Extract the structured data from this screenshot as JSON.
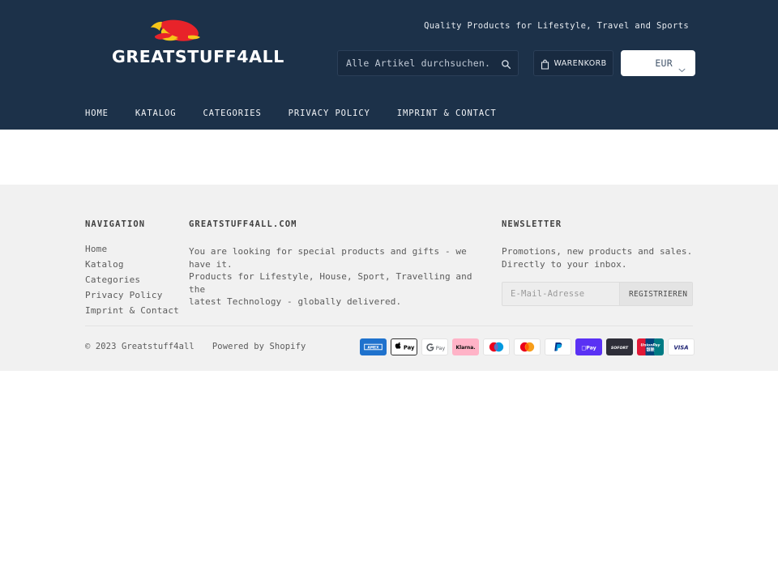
{
  "theme": {
    "header_bg": "#1c3149",
    "footer_bg": "#f1f1f1",
    "body_bg": "#ffffff",
    "logo_red": "#e8232a",
    "logo_yellow": "#f5c518",
    "accent_text": "#5b5b5b"
  },
  "header": {
    "logo_text": "GREATSTUFF4ALL",
    "logo_icon": "flame-swoosh-logo",
    "tagline": "Quality Products for Lifestyle, Travel and Sports",
    "search": {
      "placeholder": "Alle Artikel durchsuchen...",
      "value": "",
      "icon": "search-icon"
    },
    "cart": {
      "label": "WARENKORB",
      "icon": "shopping-bag-icon"
    },
    "currency": {
      "selected": "EUR",
      "icon": "chevron-down-icon",
      "options": [
        "EUR"
      ]
    }
  },
  "nav": {
    "items": [
      {
        "label": "HOME"
      },
      {
        "label": "KATALOG"
      },
      {
        "label": "CATEGORIES"
      },
      {
        "label": "PRIVACY POLICY"
      },
      {
        "label": "IMPRINT & CONTACT"
      }
    ]
  },
  "footer": {
    "navigation": {
      "title": "NAVIGATION",
      "links": [
        {
          "label": "Home"
        },
        {
          "label": "Katalog"
        },
        {
          "label": "Categories"
        },
        {
          "label": "Privacy Policy"
        },
        {
          "label": "Imprint & Contact"
        }
      ]
    },
    "about": {
      "title": "GREATSTUFF4ALL.COM",
      "text": "You are looking for special products and gifts - we have it.\nProducts for Lifestyle, House, Sport, Travelling and the\nlatest Technology - globally delivered."
    },
    "newsletter": {
      "title": "NEWSLETTER",
      "text": "Promotions, new products and sales.\nDirectly to your inbox.",
      "email_placeholder": "E-Mail-Adresse",
      "email_value": "",
      "submit_label": "REGISTRIEREN"
    },
    "bottom": {
      "copyright": "© 2023 Greatstuff4all",
      "powered_by": "Powered by Shopify",
      "payment_methods": [
        {
          "name": "american-express",
          "label": "AMEX"
        },
        {
          "name": "apple-pay",
          "label": "Pay"
        },
        {
          "name": "google-pay",
          "label": "G Pay"
        },
        {
          "name": "klarna",
          "label": "Klarna."
        },
        {
          "name": "maestro",
          "label": "Maestro"
        },
        {
          "name": "mastercard",
          "label": "Mastercard"
        },
        {
          "name": "paypal",
          "label": "PayPal"
        },
        {
          "name": "shop-pay",
          "label": "shop Pay"
        },
        {
          "name": "sofort",
          "label": "SOFORT"
        },
        {
          "name": "union-pay",
          "label": "UnionPay"
        },
        {
          "name": "visa",
          "label": "VISA"
        }
      ]
    }
  }
}
